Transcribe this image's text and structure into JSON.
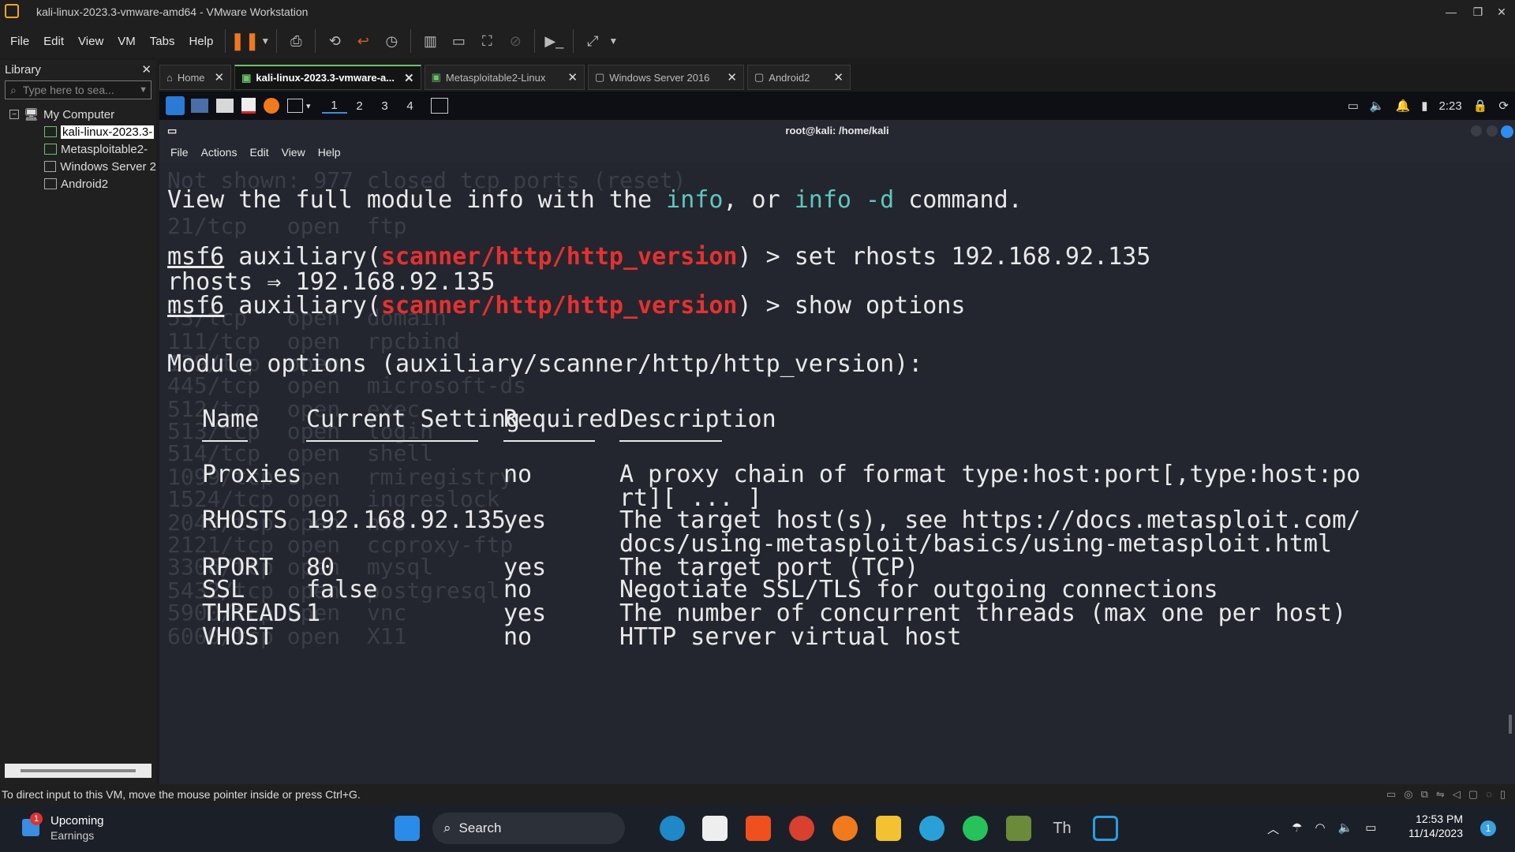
{
  "window": {
    "title": "kali-linux-2023.3-vmware-amd64 - VMware Workstation"
  },
  "menubar": {
    "items": [
      "File",
      "Edit",
      "View",
      "VM",
      "Tabs",
      "Help"
    ]
  },
  "library": {
    "title": "Library",
    "search_placeholder": "Type here to sea...",
    "root": "My Computer",
    "vms": [
      "kali-linux-2023.3-",
      "Metasploitable2-",
      "Windows Server 2",
      "Android2"
    ]
  },
  "tabs": [
    {
      "label": "Home"
    },
    {
      "label": "kali-linux-2023.3-vmware-a..."
    },
    {
      "label": "Metasploitable2-Linux"
    },
    {
      "label": "Windows Server 2016"
    },
    {
      "label": "Android2"
    }
  ],
  "xfce": {
    "workspaces": [
      "1",
      "2",
      "3",
      "4"
    ],
    "clock": "2:23"
  },
  "terminal": {
    "title": "root@kali: /home/kali",
    "menu": [
      "File",
      "Actions",
      "Edit",
      "View",
      "Help"
    ],
    "line1_a": "View the full module info with the ",
    "line1_b": "info",
    "line1_c": ", or ",
    "line1_d": "info -d",
    "line1_e": " command.",
    "prompt_msf": "msf6",
    "prompt_aux": " auxiliary(",
    "prompt_module": "scanner/http/http_version",
    "prompt_close": ") > ",
    "cmd1": "set rhosts 192.168.92.135",
    "resp1": "rhosts ⇒ 192.168.92.135",
    "cmd2": "show options",
    "module_header": "Module options (auxiliary/scanner/http/http_version):",
    "columns": [
      "Name",
      "Current Setting",
      "Required",
      "Description"
    ],
    "options": [
      {
        "name": "Proxies",
        "setting": "",
        "required": "no",
        "desc": "A proxy chain of format type:host:port[,type:host:po",
        "desc2": "rt][ ... ]"
      },
      {
        "name": "RHOSTS",
        "setting": "192.168.92.135",
        "required": "yes",
        "desc": "The target host(s), see https://docs.metasploit.com/",
        "desc2": "docs/using-metasploit/basics/using-metasploit.html"
      },
      {
        "name": "RPORT",
        "setting": "80",
        "required": "yes",
        "desc": "The target port (TCP)",
        "desc2": ""
      },
      {
        "name": "SSL",
        "setting": "false",
        "required": "no",
        "desc": "Negotiate SSL/TLS for outgoing connections",
        "desc2": ""
      },
      {
        "name": "THREADS",
        "setting": "1",
        "required": "yes",
        "desc": "The number of concurrent threads (max one per host)",
        "desc2": ""
      },
      {
        "name": "VHOST",
        "setting": "",
        "required": "no",
        "desc": "HTTP server virtual host",
        "desc2": ""
      }
    ],
    "ghost_lines": [
      "Not shown: 977 closed tcp ports (reset)",
      "21/tcp   open  ftp",
      "53/tcp   open  domain",
      "111/tcp  open  rpcbind",
      "139/tcp  open",
      "445/tcp  open  microsoft-ds",
      "512/tcp  open  exec",
      "513/tcp  open  login",
      "514/tcp  open  shell",
      "1099/tcp open  rmiregistry",
      "1524/tcp open  ingreslock",
      "2049/tcp open  nfs",
      "2121/tcp open  ccproxy-ftp",
      "3306/tcp open  mysql",
      "5432/tcp open  postgresql",
      "5900/tcp open  vnc",
      "6000/tcp open  X11"
    ]
  },
  "statusbar": {
    "text": "To direct input to this VM, move the mouse pointer inside or press Ctrl+G."
  },
  "taskbar": {
    "widget_title": "Upcoming",
    "widget_sub": "Earnings",
    "widget_badge": "1",
    "search": "Search",
    "time": "12:53 PM",
    "date": "11/14/2023",
    "notif": "1"
  }
}
